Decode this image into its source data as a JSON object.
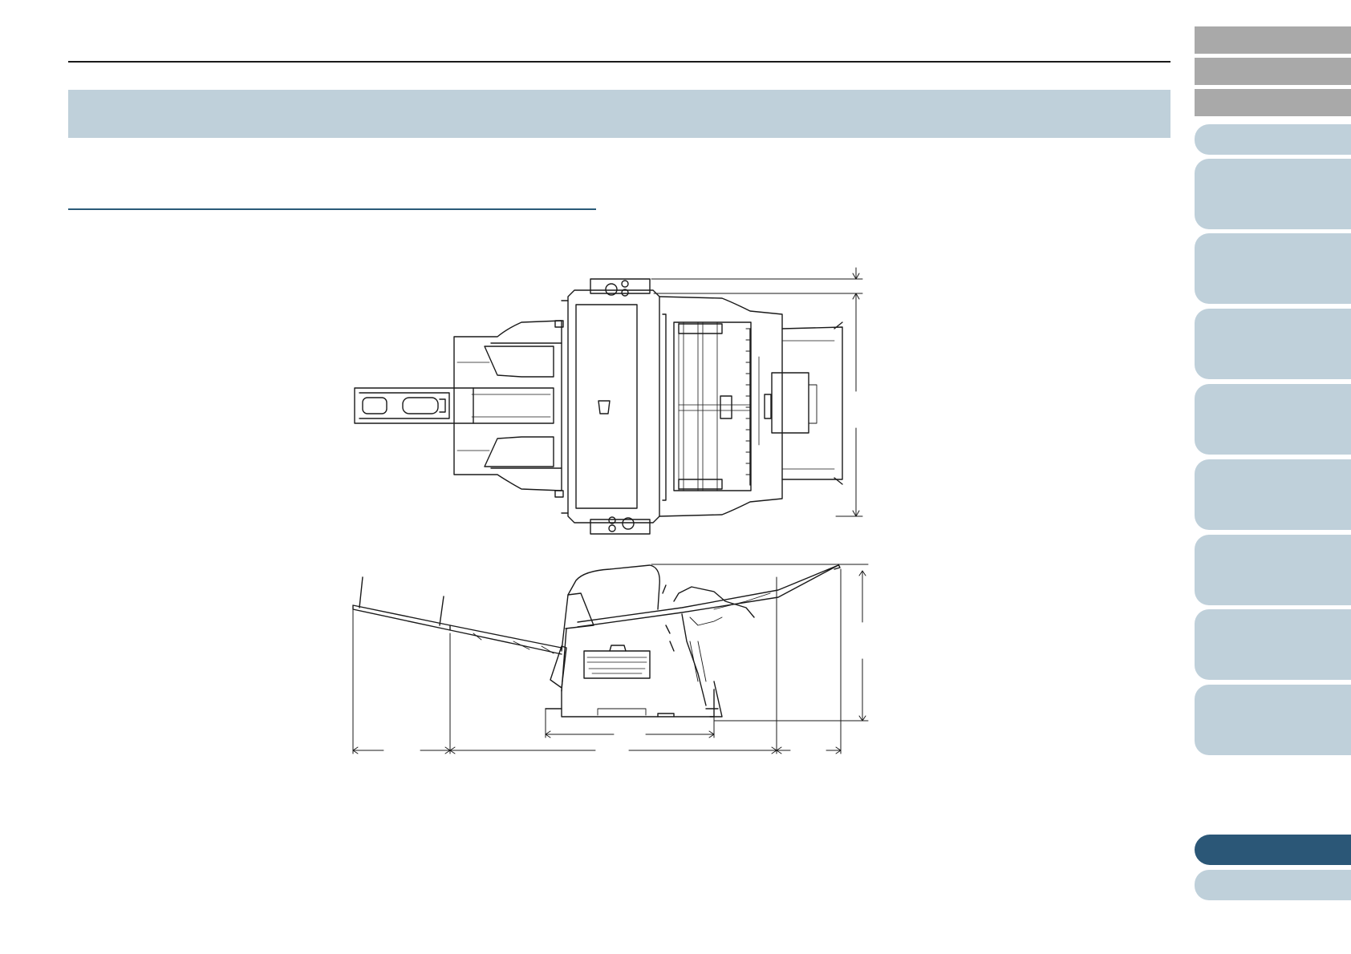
{
  "page": {
    "header_title": "",
    "section_heading": ""
  },
  "side_nav": {
    "gray_tabs": [
      "",
      "",
      ""
    ],
    "blue_tabs": [
      "",
      "",
      "",
      "",
      "",
      "",
      "",
      "",
      ""
    ],
    "bottom_tabs": [
      "",
      ""
    ]
  },
  "colors": {
    "title_band": "#bfd0da",
    "section_rule": "#2a5a78",
    "nav_gray": "#a9a9a9",
    "nav_blue": "#bfd0da",
    "nav_active": "#2b5777"
  },
  "figures": [
    {
      "name": "scanner-top-view",
      "type": "outline drawing with dimension lines"
    },
    {
      "name": "scanner-side-view",
      "type": "outline drawing with dimension lines"
    }
  ]
}
